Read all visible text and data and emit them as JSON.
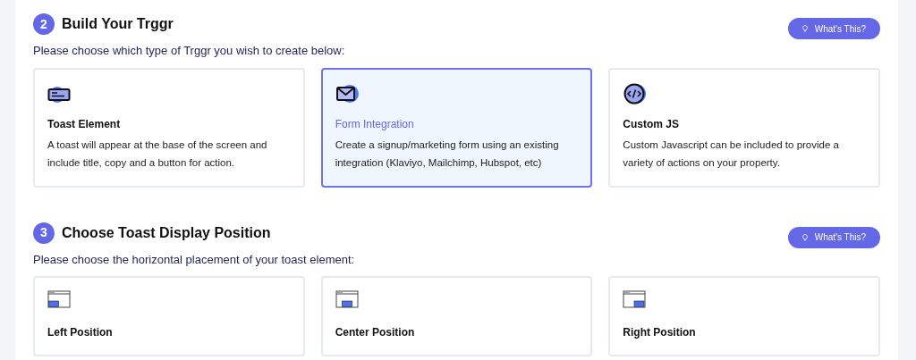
{
  "sections": [
    {
      "number": "2",
      "title": "Build Your Trggr",
      "help_button": {
        "label": "What's This?"
      },
      "prompt": "Please choose which type of Trggr you wish to create below:",
      "options": [
        {
          "kind": "toast",
          "title": "Toast Element",
          "description": "A toast will appear at the base of the screen and include title, copy and a button for action.",
          "selected": false
        },
        {
          "kind": "form",
          "title": "Form Integration",
          "description": "Create a signup/marketing form using an existing integration (Klaviyo, Mailchimp, Hubspot, etc)",
          "selected": true
        },
        {
          "kind": "code",
          "title": "Custom JS",
          "description": "Custom Javascript can be included to provide a variety of actions on your property.",
          "selected": false
        }
      ]
    },
    {
      "number": "3",
      "title": "Choose Toast Display Position",
      "help_button": {
        "label": "What's This?"
      },
      "prompt": "Please choose the horizontal placement of your toast element:",
      "options": [
        {
          "kind": "left",
          "title": "Left Position",
          "selected": false
        },
        {
          "kind": "center",
          "title": "Center Position",
          "selected": false
        },
        {
          "kind": "right",
          "title": "Right Position",
          "selected": false
        }
      ]
    }
  ]
}
